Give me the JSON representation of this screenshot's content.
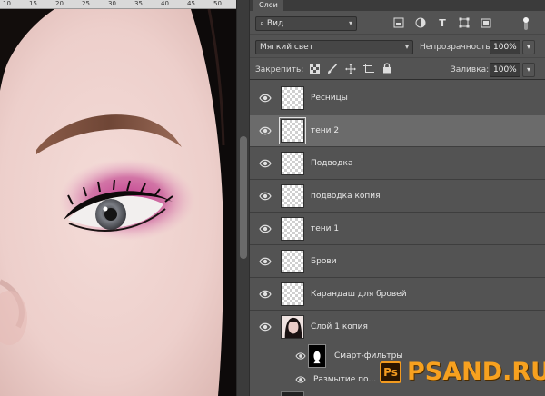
{
  "ruler": {
    "ticks": [
      "10",
      "15",
      "20",
      "25",
      "30",
      "35",
      "40",
      "45",
      "50"
    ]
  },
  "panel": {
    "tab_label": "Слои",
    "filter": {
      "kind_label": "Вид",
      "chevron": "⌄"
    },
    "blend": {
      "mode": "Мягкий свет",
      "opacity_label": "Непрозрачность:",
      "opacity_value": "100%"
    },
    "lock": {
      "label": "Закрепить:",
      "fill_label": "Заливка:",
      "fill_value": "100%"
    },
    "layers": [
      {
        "name": "Ресницы",
        "visible": true,
        "selected": false
      },
      {
        "name": "тени 2",
        "visible": true,
        "selected": true
      },
      {
        "name": "Подводка",
        "visible": true,
        "selected": false
      },
      {
        "name": "подводка копия",
        "visible": true,
        "selected": false
      },
      {
        "name": "тени 1",
        "visible": true,
        "selected": false
      },
      {
        "name": "Брови",
        "visible": true,
        "selected": false
      },
      {
        "name": "Карандаш для бровей",
        "visible": true,
        "selected": false
      },
      {
        "name": "Слой 1 копия",
        "visible": true,
        "selected": false,
        "thumbnail": "photo"
      }
    ],
    "smart_filters_label": "Смарт-фильтры",
    "blur_filter_label": "Размытие по..."
  },
  "watermark": {
    "logo": "Ps",
    "text": "PSAND.RU"
  },
  "colors": {
    "panel_bg": "#535353",
    "selected_row": "#6b6b6b",
    "eyeshadow": "#c44a92",
    "watermark": "#f7a11f"
  }
}
